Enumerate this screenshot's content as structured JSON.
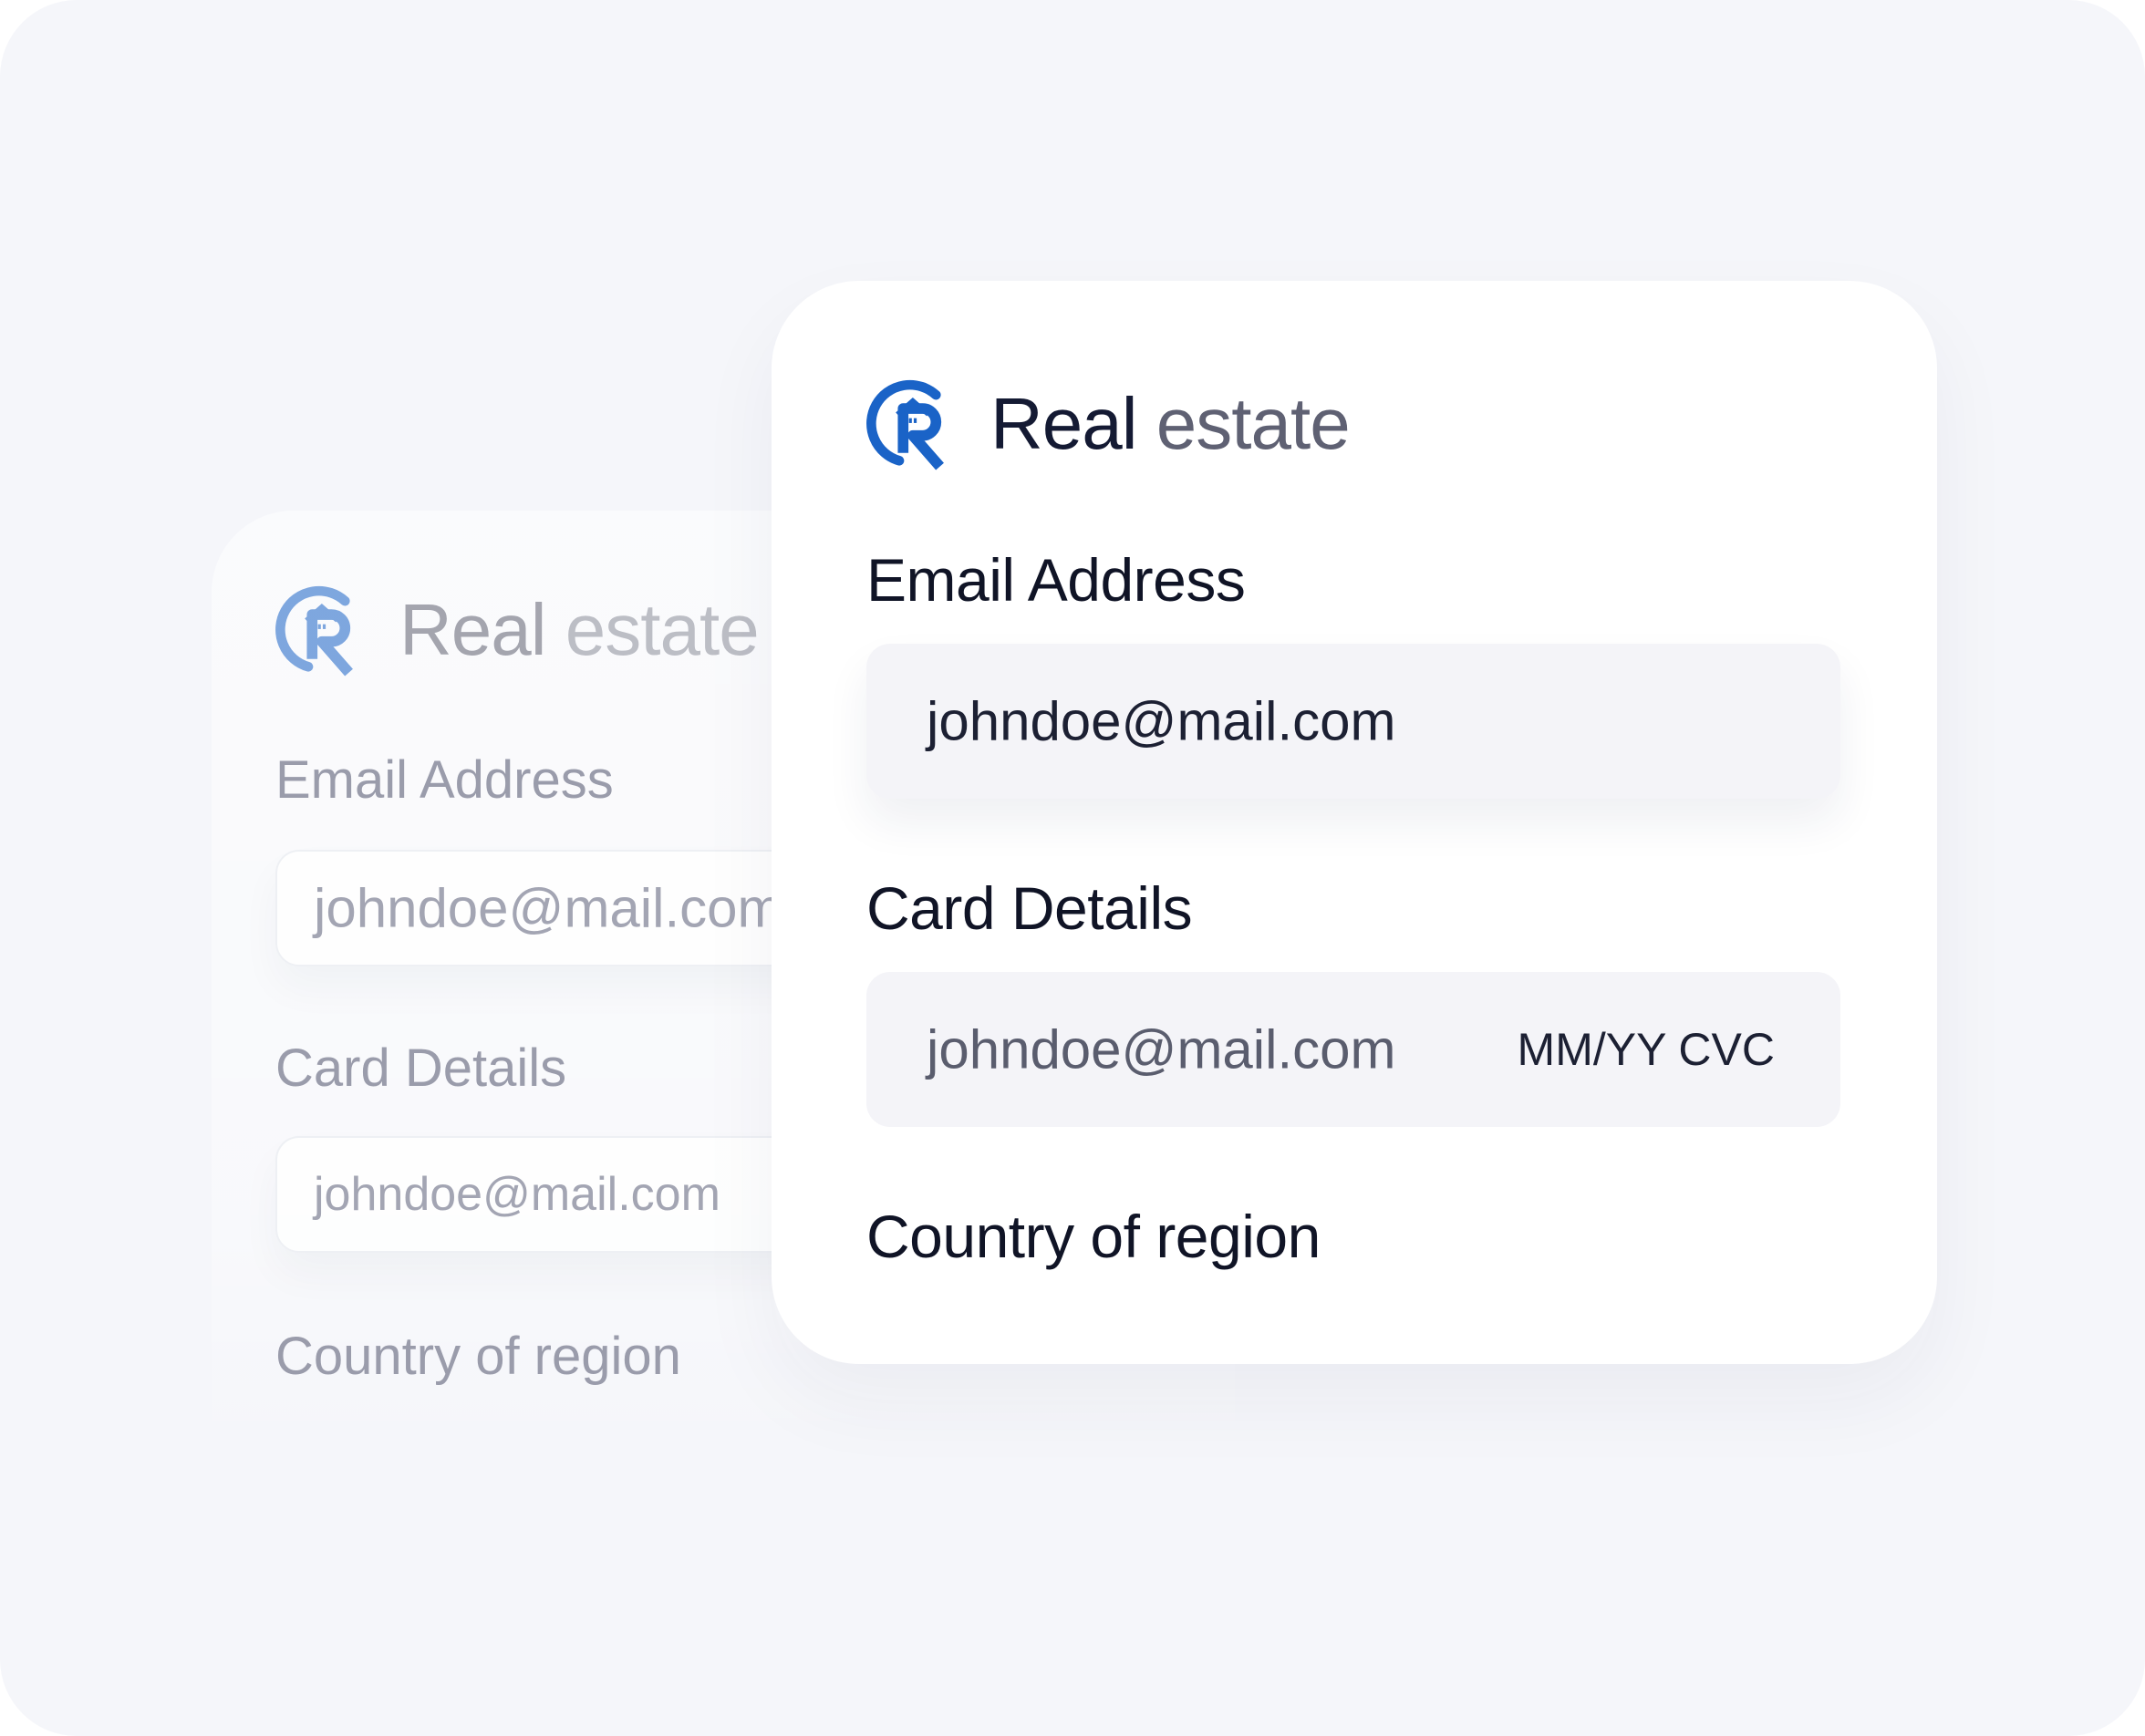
{
  "brand": {
    "name_primary": "Real",
    "name_secondary": "estate",
    "logo_icon": "real-estate-r-house-logo",
    "logo_color": "#1a63c7"
  },
  "form": {
    "email_label": "Email Address",
    "email_value": "johndoe@mail.com",
    "card_label": "Card Details",
    "card_value": "johndoe@mail.com",
    "card_expiry_cvc": "MM/YY CVC",
    "country_label": "Country of region"
  },
  "background_form": {
    "email_label": "Email Address",
    "email_value": "johndoe@mail.com",
    "card_label": "Card Details",
    "card_value": "johndoe@mail.com",
    "country_label": "Country of region"
  }
}
